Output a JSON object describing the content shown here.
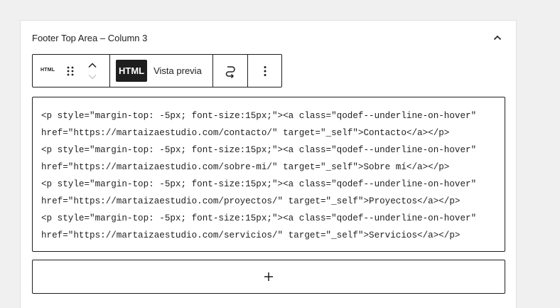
{
  "panel": {
    "title": "Footer Top Area – Column 3"
  },
  "toolbar": {
    "block_icon_label": "HTML",
    "html_tab_label": "HTML",
    "preview_tab_label": "Vista previa"
  },
  "editor": {
    "lines": [
      "<p style=\"margin-top: -5px; font-size:15px;\"><a class=\"qodef--underline-on-hover\"",
      "href=\"https://martaizaestudio.com/contacto/\" target=\"_self\">Contacto</a></p>",
      "<p style=\"margin-top: -5px; font-size:15px;\"><a class=\"qodef--underline-on-hover\"",
      "href=\"https://martaizaestudio.com/sobre-mi/\" target=\"_self\">Sobre mí</a></p>",
      "<p style=\"margin-top: -5px; font-size:15px;\"><a class=\"qodef--underline-on-hover\"",
      "href=\"https://martaizaestudio.com/proyectos/\" target=\"_self\">Proyectos</a></p>",
      "<p style=\"margin-top: -5px; font-size:15px;\"><a class=\"qodef--underline-on-hover\"",
      "href=\"https://martaizaestudio.com/servicios/\" target=\"_self\">Servicios</a></p>"
    ]
  },
  "icons": {
    "collapse": "chevron-up-icon",
    "drag": "drag-handle-icon",
    "move_up": "chevron-up-icon",
    "move_down": "chevron-down-icon",
    "transform": "transform-icon",
    "more": "more-vertical-icon",
    "add": "plus-icon"
  },
  "colors": {
    "text": "#1e1e1e",
    "border": "#1e1e1e",
    "background": "#f0f0f1",
    "disabled": "#cccccc"
  }
}
